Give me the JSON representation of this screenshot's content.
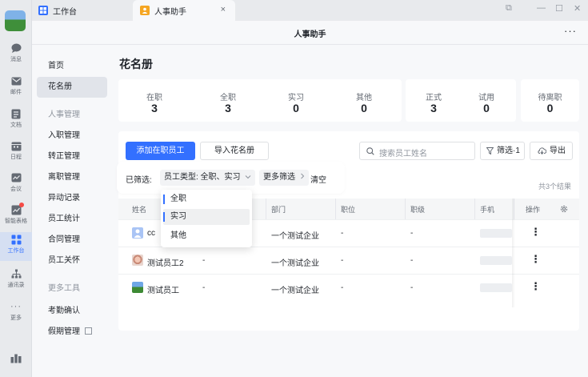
{
  "rail": {
    "items": [
      {
        "label": "消息",
        "icon": "chat-bubble-icon"
      },
      {
        "label": "邮件",
        "icon": "mail-icon"
      },
      {
        "label": "文档",
        "icon": "doc-icon"
      },
      {
        "label": "日程",
        "icon": "calendar-icon"
      },
      {
        "label": "会议",
        "icon": "video-meeting-icon"
      },
      {
        "label": "智能表格",
        "icon": "smart-sheet-icon"
      },
      {
        "label": "工作台",
        "icon": "workbench-grid-icon",
        "active": true
      },
      {
        "label": "通讯录",
        "icon": "contacts-icon"
      },
      {
        "label": "更多",
        "icon": "more-dots-icon"
      }
    ]
  },
  "titlebar": {
    "tabs": [
      {
        "label": "工作台"
      },
      {
        "label": "人事助手",
        "close": "×"
      }
    ],
    "controls": {
      "pop": "⧉",
      "minimize": "—",
      "maximize": "☐",
      "close": "✕"
    }
  },
  "header": {
    "title": "人事助手",
    "more": "···"
  },
  "subnav": {
    "items": [
      "首页",
      "花名册"
    ],
    "group1": "人事管理",
    "group1_items": [
      "入职管理",
      "转正管理",
      "离职管理",
      "异动记录",
      "员工统计",
      "合同管理",
      "员工关怀"
    ],
    "group2": "更多工具",
    "group2_items": [
      "考勤确认",
      "假期管理"
    ]
  },
  "page": {
    "title": "花名册"
  },
  "stats": {
    "card1": [
      {
        "label": "在职",
        "value": "3"
      },
      {
        "label": "全职",
        "value": "3"
      },
      {
        "label": "实习",
        "value": "0"
      },
      {
        "label": "其他",
        "value": "0"
      }
    ],
    "card2": [
      {
        "label": "正式",
        "value": "3"
      },
      {
        "label": "试用",
        "value": "0"
      }
    ],
    "card3": [
      {
        "label": "待离职",
        "value": "0"
      }
    ]
  },
  "toolbar": {
    "add_label": "添加在职员工",
    "import_label": "导入花名册",
    "search_placeholder": "搜索员工姓名",
    "filter_label": "筛选·1",
    "export_label": "导出"
  },
  "filters": {
    "prefix": "已筛选:",
    "chip_type": "员工类型: 全职、实习",
    "more": "更多筛选",
    "clear": "清空"
  },
  "total": "共3个结果",
  "table": {
    "columns": [
      "姓名",
      "部门",
      "职位",
      "职级",
      "手机",
      "操作"
    ],
    "rows": [
      {
        "name": "cc",
        "dept": "一个测试企业",
        "pos": "-",
        "level": "-",
        "avatar": "cc"
      },
      {
        "name": "测试员工2",
        "col2": "-",
        "dept": "一个测试企业",
        "pos": "-",
        "level": "-",
        "avatar": "photo"
      },
      {
        "name": "测试员工",
        "col2": "-",
        "dept": "一个测试企业",
        "pos": "-",
        "level": "-",
        "avatar": "landscape"
      }
    ],
    "op": "⋮"
  },
  "dropdown": {
    "options": [
      {
        "label": "全职",
        "checked": true
      },
      {
        "label": "实习",
        "checked": true,
        "hover": true
      },
      {
        "label": "其他",
        "checked": false
      }
    ]
  },
  "colors": {
    "accent": "#3370ff",
    "bg": "#f7f8fa",
    "card": "#ffffff"
  }
}
